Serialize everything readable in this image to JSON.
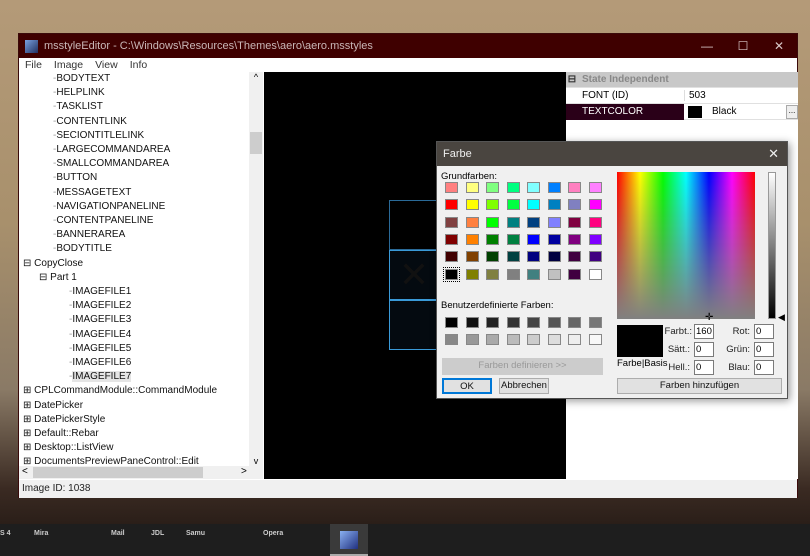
{
  "window": {
    "title": "msstyleEditor - C:\\Windows\\Resources\\Themes\\aero\\aero.msstyles",
    "min": "—",
    "max": "☐",
    "close": "✕"
  },
  "menu": [
    "File",
    "Image",
    "View",
    "Info"
  ],
  "tree": [
    {
      "label": "BODYTEXT",
      "level": 2
    },
    {
      "label": "HELPLINK",
      "level": 2
    },
    {
      "label": "TASKLIST",
      "level": 2
    },
    {
      "label": "CONTENTLINK",
      "level": 2
    },
    {
      "label": "SECIONTITLELINK",
      "level": 2
    },
    {
      "label": "LARGECOMMANDAREA",
      "level": 2
    },
    {
      "label": "SMALLCOMMANDAREA",
      "level": 2
    },
    {
      "label": "BUTTON",
      "level": 2
    },
    {
      "label": "MESSAGETEXT",
      "level": 2
    },
    {
      "label": "NAVIGATIONPANELINE",
      "level": 2
    },
    {
      "label": "CONTENTPANELINE",
      "level": 2
    },
    {
      "label": "BANNERAREA",
      "level": 2
    },
    {
      "label": "BODYTITLE",
      "level": 2
    },
    {
      "label": "CopyClose",
      "level": 0,
      "exp": "⊟"
    },
    {
      "label": "Part 1",
      "level": 1,
      "exp": "⊟"
    },
    {
      "label": "IMAGEFILE1",
      "level": 3
    },
    {
      "label": "IMAGEFILE2",
      "level": 3
    },
    {
      "label": "IMAGEFILE3",
      "level": 3
    },
    {
      "label": "IMAGEFILE4",
      "level": 3
    },
    {
      "label": "IMAGEFILE5",
      "level": 3
    },
    {
      "label": "IMAGEFILE6",
      "level": 3
    },
    {
      "label": "IMAGEFILE7",
      "level": 3,
      "selected": true
    },
    {
      "label": "CPLCommandModule::CommandModule",
      "level": 0,
      "exp": "⊞"
    },
    {
      "label": "DatePicker",
      "level": 0,
      "exp": "⊞"
    },
    {
      "label": "DatePickerStyle",
      "level": 0,
      "exp": "⊞"
    },
    {
      "label": "Default::Rebar",
      "level": 0,
      "exp": "⊞"
    },
    {
      "label": "Desktop::ListView",
      "level": 0,
      "exp": "⊞"
    },
    {
      "label": "DocumentsPreviewPaneControl::Edit",
      "level": 0,
      "exp": "⊞"
    }
  ],
  "status": "Image ID: 1038",
  "props": {
    "group": "State Independent",
    "rows": [
      {
        "name": "FONT (ID)",
        "value": "503"
      },
      {
        "name": "TEXTCOLOR",
        "value": "Black",
        "color": "#000000",
        "selected": true
      }
    ],
    "more": "..."
  },
  "dialog": {
    "title": "Farbe",
    "close": "✕",
    "basic_label": "Grundfarben:",
    "custom_label": "Benutzerdefinierte Farben:",
    "basic": [
      "#ff8080",
      "#ffff80",
      "#80ff80",
      "#00ff80",
      "#80ffff",
      "#0080ff",
      "#ff80c0",
      "#ff80ff",
      "#ff0000",
      "#ffff00",
      "#80ff00",
      "#00ff40",
      "#00ffff",
      "#0080c0",
      "#8080c0",
      "#ff00ff",
      "#804040",
      "#ff8040",
      "#00ff00",
      "#008080",
      "#004080",
      "#8080ff",
      "#800040",
      "#ff0080",
      "#800000",
      "#ff8000",
      "#008000",
      "#008040",
      "#0000ff",
      "#0000a0",
      "#800080",
      "#8000ff",
      "#400000",
      "#804000",
      "#004000",
      "#004040",
      "#000080",
      "#000040",
      "#400040",
      "#400080",
      "#000000",
      "#808000",
      "#808040",
      "#808080",
      "#408080",
      "#c0c0c0",
      "#400040",
      "#ffffff"
    ],
    "custom": [
      "#000000",
      "#111111",
      "#222222",
      "#333333",
      "#444444",
      "#555555",
      "#666666",
      "#777777",
      "#888888",
      "#999999",
      "#aaaaaa",
      "#bbbbbb",
      "#cccccc",
      "#dddddd",
      "#eeeeee",
      "#f8f8f8"
    ],
    "define": "Farben definieren >>",
    "ok": "OK",
    "cancel": "Abbrechen",
    "preview_label": "Farbe|Basis",
    "add": "Farben hinzufügen",
    "fields": {
      "hue_label": "Farbt.:",
      "hue": "160",
      "sat_label": "Sätt.:",
      "sat": "0",
      "lum_label": "Hell.:",
      "lum": "0",
      "red_label": "Rot:",
      "red": "0",
      "green_label": "Grün:",
      "green": "0",
      "blue_label": "Blau:",
      "blue": "0"
    }
  },
  "taskbar": [
    "S 4",
    "Mira",
    "Mail",
    "JDL",
    "Samu",
    "Opera"
  ]
}
